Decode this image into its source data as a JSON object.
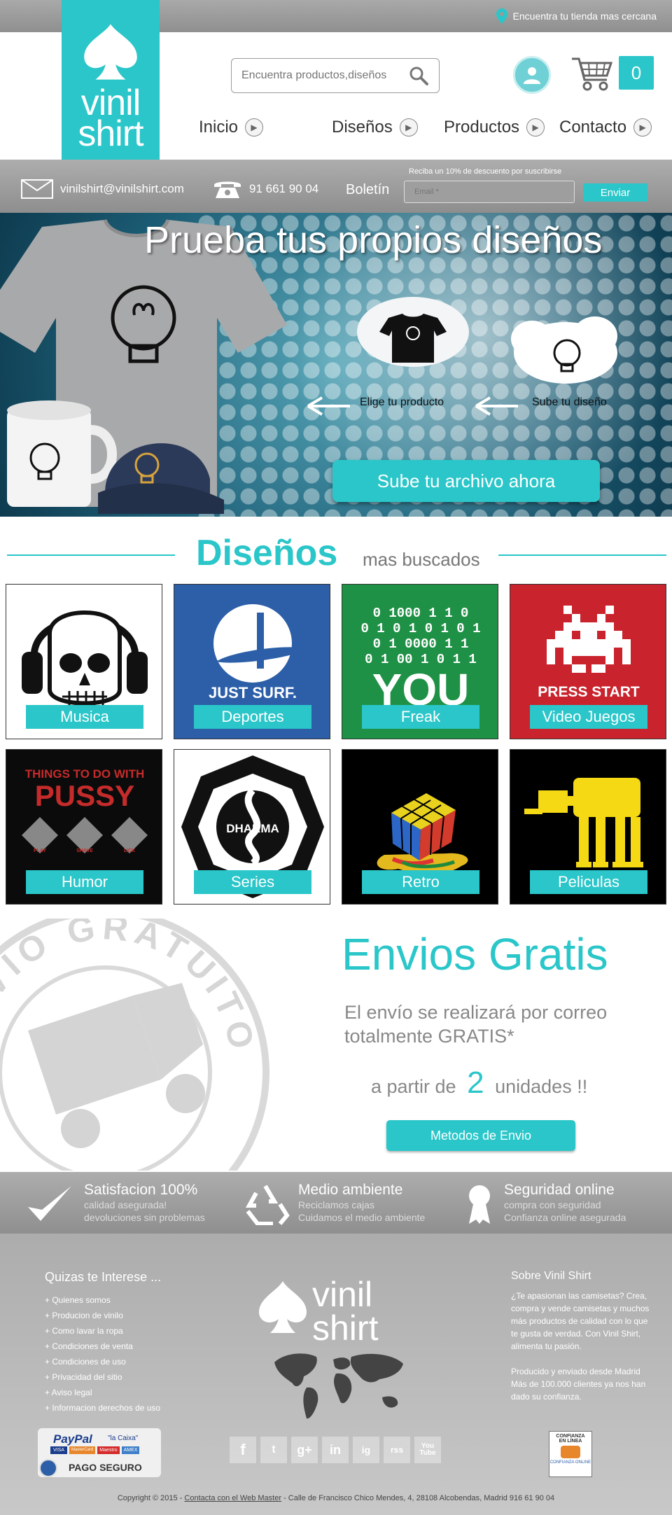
{
  "topbar": {
    "store_finder": "Encuentra tu tienda mas cercana"
  },
  "brand": {
    "line1": "vinil",
    "line2": "shirt"
  },
  "search": {
    "placeholder": "Encuentra productos,diseños"
  },
  "cart": {
    "count": "0"
  },
  "nav": [
    {
      "label": "Inicio"
    },
    {
      "label": "Diseños"
    },
    {
      "label": "Productos"
    },
    {
      "label": "Contacto"
    }
  ],
  "contact": {
    "email": "vinilshirt@vinilshirt.com",
    "phone": "91 661 90 04",
    "newsletter_label": "Boletín",
    "newsletter_note": "Reciba un 10% de descuento por suscribirse",
    "email_placeholder": "Email *",
    "send_label": "Enviar"
  },
  "hero": {
    "title": "Prueba tus propios diseños",
    "step1": "Elige tu producto",
    "step2": "Sube tu diseño",
    "cta": "Sube tu archivo ahora"
  },
  "designs": {
    "title": "Diseños",
    "subtitle": "mas buscados",
    "cards": [
      {
        "label": "Musica"
      },
      {
        "label": "Deportes"
      },
      {
        "label": "Freak"
      },
      {
        "label": "Video Juegos"
      },
      {
        "label": "Humor"
      },
      {
        "label": "Series"
      },
      {
        "label": "Retro"
      },
      {
        "label": "Peliculas"
      }
    ],
    "art_text": {
      "surf": "JUST SURF.",
      "binary": [
        "0 1000 1 1 0",
        "0 1 0 1 0 1 0 1",
        "0 1 0000 1 1",
        "0 1 00 1 0 1 1"
      ],
      "you": "YOU",
      "press_start": "PRESS START",
      "humor_top": "THINGS TO DO WITH",
      "humor_big": "PUSSY",
      "humor_tags": [
        "PLAY",
        "SHAVE",
        "LICK"
      ],
      "dharma": "DHARMA"
    }
  },
  "shipping": {
    "stamp_text": "ENVIO GRATUITO",
    "title": "Envios Gratis",
    "line1": "El envío se realizará por correo",
    "line2": "totalmente GRATIS*",
    "qty_prefix": "a partir de",
    "qty": "2",
    "qty_suffix": "unidades !!",
    "button": "Metodos de Envio"
  },
  "features": [
    {
      "title": "Satisfacion 100%",
      "lines": [
        "calidad asegurada!",
        "devoluciones sin problemas"
      ]
    },
    {
      "title": "Medio ambiente",
      "lines": [
        "Reciclamos cajas",
        "Cuidamos el medio ambiente"
      ]
    },
    {
      "title": "Seguridad online",
      "lines": [
        "compra con seguridad",
        "Confianza online asegurada"
      ]
    }
  ],
  "footer": {
    "links_title": "Quizas te Interese ...",
    "links": [
      "+ Quienes somos",
      "+ Producion de vinilo",
      "+ Como lavar la ropa",
      "+ Condiciones de venta",
      "+ Condiciones de uso",
      "+ Privacidad del sitio",
      "+ Aviso legal",
      "+ Informacion derechos de uso"
    ],
    "about_title": "Sobre Vinil Shirt",
    "about_p1": "¿Te apasionan las camisetas? Crea, compra y vende camisetas y muchos más productos de calidad con lo que te gusta de verdad. Con Vinil Shirt, alimenta tu pasión.",
    "about_p2": "Producido y enviado desde Madrid Más de 100.000 clientes ya nos han dado su confianza.",
    "payment_brand": "PayPal",
    "payment_bank": "\"la Caixa\"",
    "payment_cards": [
      "VISA",
      "MasterCard",
      "Maestro",
      "AMEX"
    ],
    "payment_label": "PAGO SEGURO",
    "socials": [
      "f",
      "t",
      "g+",
      "in",
      "ig",
      "rss",
      "You Tube"
    ],
    "trust_lines": [
      "CONFIANZA",
      "EN LÍNEA",
      "CONFIANZA ONLINE"
    ],
    "copyright_prefix": "Copyright © 2015  -",
    "copyright_link": "Contacta con el Web Master",
    "copyright_suffix": " -  Calle de Francisco Chico Mendes, 4, 28108 Alcobendas, Madrid  916 61 90 04"
  },
  "colors": {
    "accent": "#2ac6c9",
    "bar_gray": "#9e9e9e"
  }
}
